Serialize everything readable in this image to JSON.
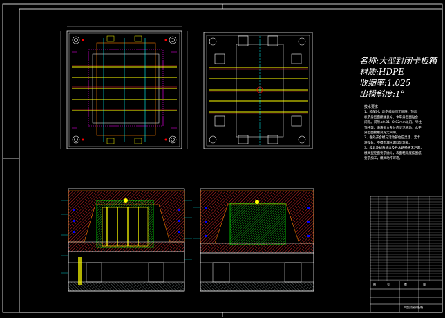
{
  "specs": {
    "name_label": "名称:",
    "name_value": "大型封闭卡板箱",
    "material_label": "材质:",
    "material_value": "HDPE",
    "shrink_label": "收缩率:",
    "shrink_value": "1.025",
    "draft_label": "出模斜度:",
    "draft_value": "1°"
  },
  "notes": {
    "title": "技术要求",
    "lines": [
      "1、装配时，动定模板间无间隙，顶出",
      "板及分型面接触良好，水平分型面贴合",
      "间隙。间隙≤0.01~0.02mm以内。导柱",
      "顶杆等。滑块配合部位应灵活滑动，水平",
      "分型面接触良好无间隙。",
      "2、各处开合模与活动部位应灵活、无卡",
      "滞现象，不得有漏水漏料等现象。",
      "3、模具冷却系统以及各水路畅通无泄漏，",
      "模具型腔面要求抛光，表面粗糙度按图纸",
      "要求加工，模具动作可靠。"
    ]
  },
  "title_block": {
    "top_rows": [
      "图",
      "号",
      "数",
      "量"
    ],
    "bottom_label": "大型封闭卡板箱"
  },
  "colors": {
    "background": "#000000",
    "frame": "#ffffff",
    "cad_yellow": "#ffff00",
    "cad_green": "#00ff00",
    "cad_red": "#ff0000",
    "cad_blue": "#0000ff",
    "cad_magenta": "#ff00ff",
    "cad_cyan": "#00ffff",
    "cad_orange": "#ff7f00"
  }
}
